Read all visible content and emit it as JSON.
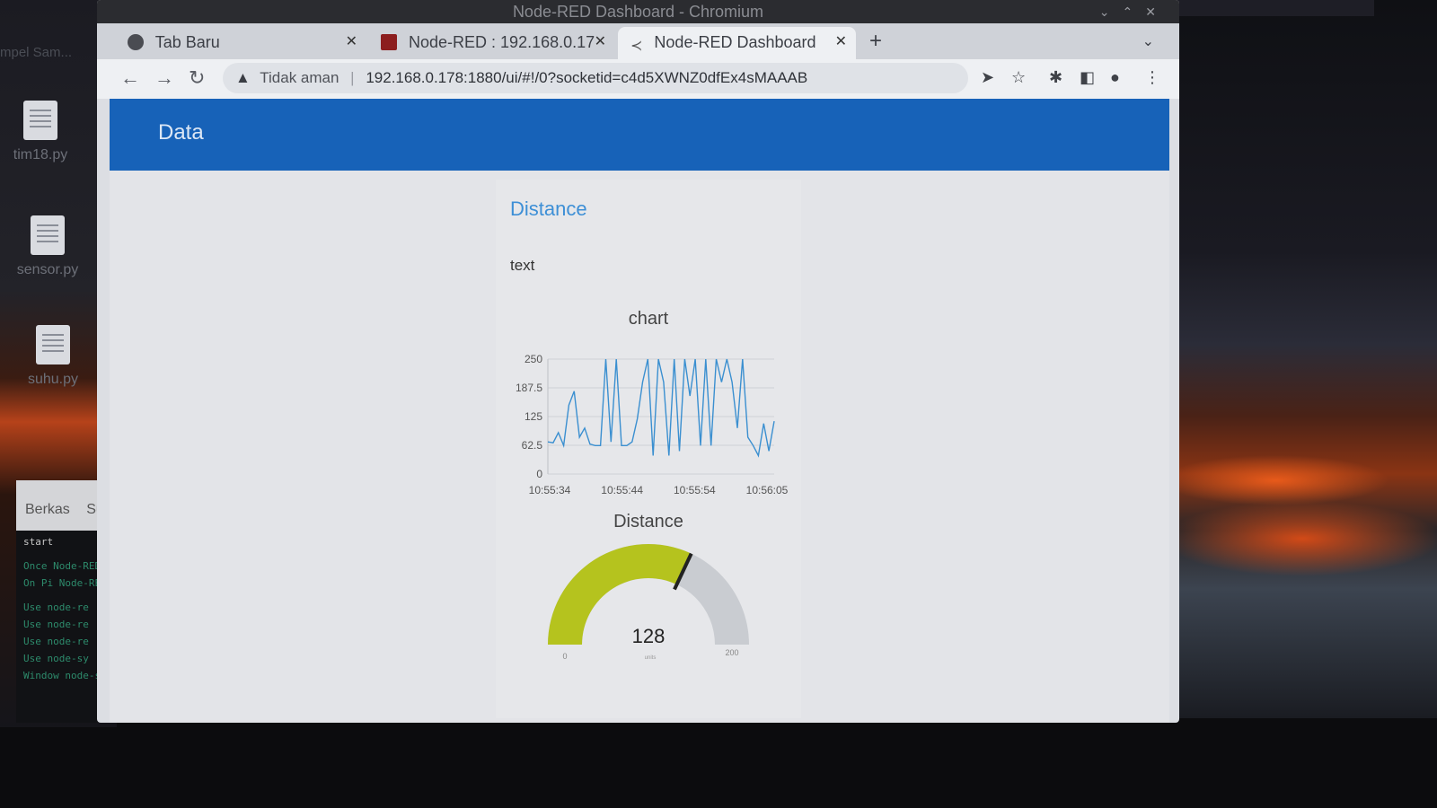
{
  "desktop": {
    "top_label": "mpel Sam...",
    "icons": [
      {
        "label": "tim18.py"
      },
      {
        "label": "sensor.py"
      },
      {
        "label": "suhu.py"
      }
    ],
    "terminal": {
      "menu": [
        "Berkas",
        "Sunt"
      ],
      "lines": [
        "start",
        "Once Node-RED",
        "On Pi Node-RED",
        "Use node-re",
        "Use node-re",
        "Use node-re",
        "Use node-sy",
        "Window node-sy"
      ]
    }
  },
  "browser": {
    "window_title": "Node-RED Dashboard - Chromium",
    "tabs": [
      {
        "label": "Tab Baru",
        "icon": "globe-icon",
        "active": false
      },
      {
        "label": "Node-RED : 192.168.0.17",
        "icon": "node-red-icon",
        "active": false
      },
      {
        "label": "Node-RED Dashboard",
        "icon": "dashboard-icon",
        "active": true
      }
    ],
    "address": {
      "security": "Tidak aman",
      "url": "192.168.0.178:1880/ui/#!/0?socketid=c4d5XWNZ0dfEx4sMAAAB"
    }
  },
  "dashboard": {
    "header_title": "Data",
    "group_title": "Distance",
    "text_widget": "text",
    "chart": {
      "title": "chart"
    },
    "gauge": {
      "title": "Distance",
      "value_label": "128",
      "min_label": "0",
      "max_label": "200",
      "units_label": "units",
      "colors": {
        "fill": "#b5c31e",
        "track": "#c9ccd1",
        "needle": "#222222"
      }
    }
  },
  "chart_data": {
    "type": "line",
    "title": "chart",
    "xlabel": "",
    "ylabel": "",
    "ylim": [
      0,
      250
    ],
    "yticks": [
      "0",
      "62.5",
      "125",
      "187.5",
      "250"
    ],
    "xticks": [
      "10:55:34",
      "10:55:44",
      "10:55:54",
      "10:56:05"
    ],
    "grid": true,
    "color": "#3a8fd0",
    "series": [
      {
        "values": [
          70,
          68,
          90,
          62,
          150,
          180,
          80,
          100,
          65,
          62,
          62,
          250,
          70,
          250,
          62,
          62,
          70,
          120,
          200,
          250,
          40,
          250,
          200,
          40,
          250,
          50,
          250,
          170,
          250,
          62,
          250,
          62,
          250,
          200,
          250,
          200,
          100,
          250,
          80,
          62,
          40,
          110,
          50,
          115
        ]
      }
    ]
  }
}
